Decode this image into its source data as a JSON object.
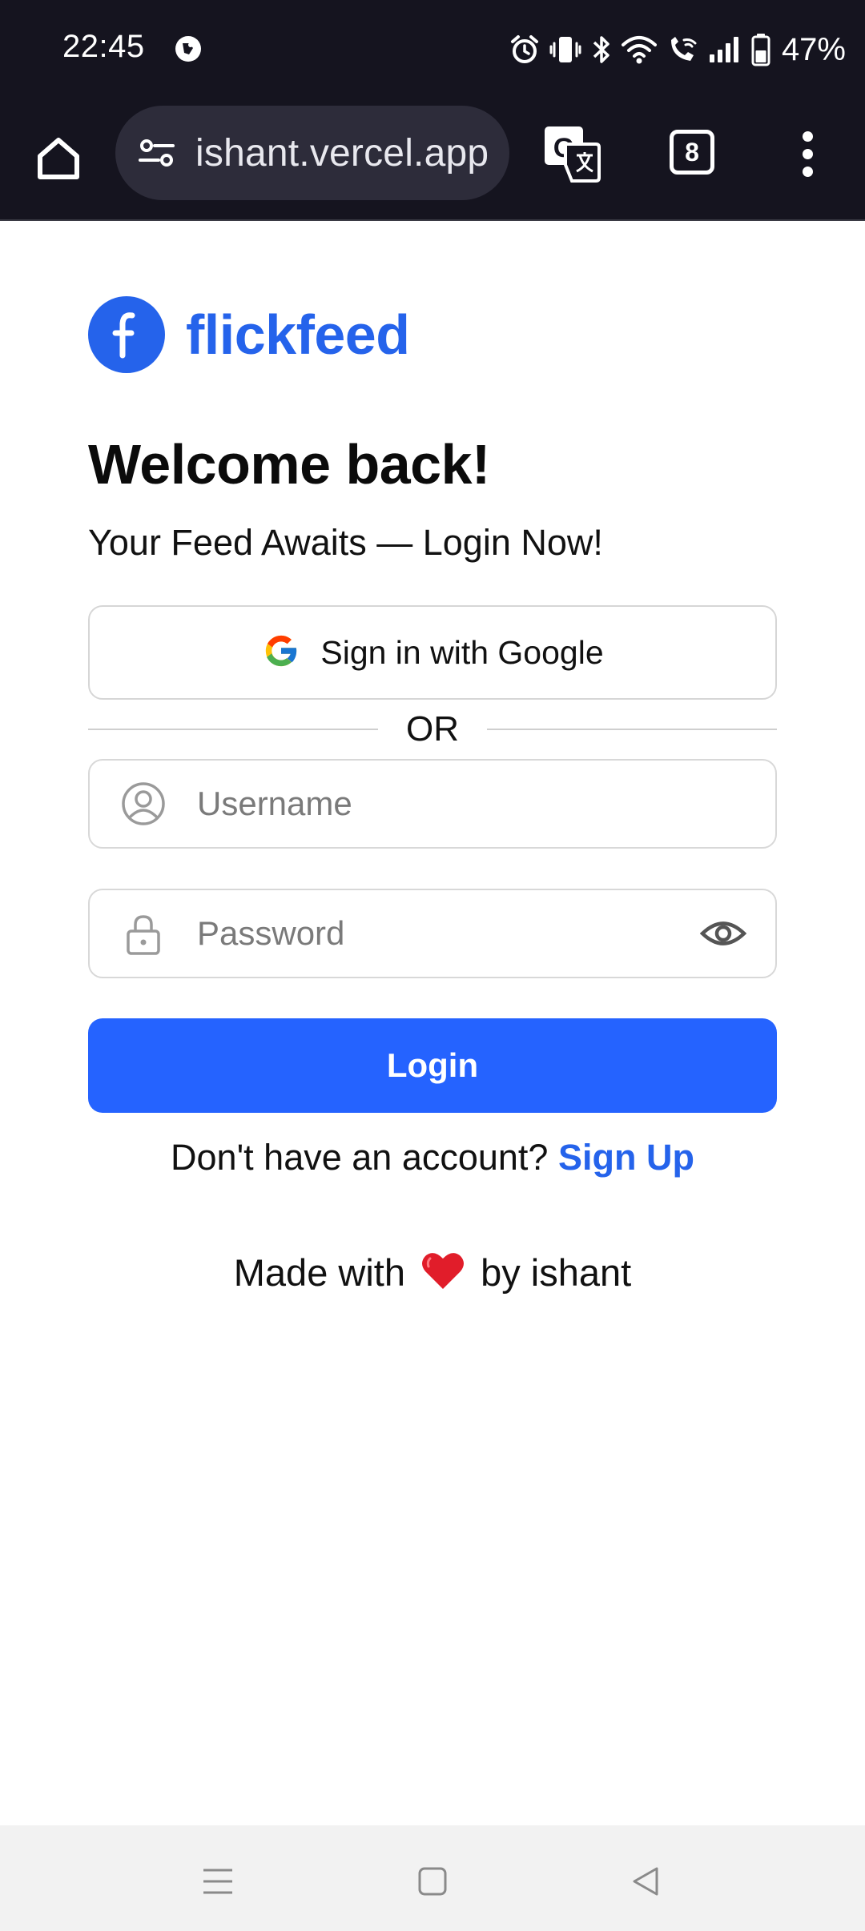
{
  "status_bar": {
    "time": "22:45",
    "battery_percent": "47%",
    "icons": [
      "app-notification-icon",
      "alarm-icon",
      "vibrate-icon",
      "bluetooth-icon",
      "wifi-icon",
      "wifi-calling-icon",
      "signal-icon",
      "battery-icon"
    ]
  },
  "browser": {
    "url": "ishant.vercel.app",
    "tab_count": "8",
    "icons": [
      "home-icon",
      "site-settings-icon",
      "translate-icon",
      "tabs-icon",
      "more-menu-icon"
    ]
  },
  "brand": {
    "logo_letter": "f",
    "name": "flickfeed",
    "color": "#2563eb"
  },
  "login": {
    "heading": "Welcome back!",
    "subtitle": "Your Feed Awaits — Login Now!",
    "google_button": "Sign in with Google",
    "divider": "OR",
    "username_placeholder": "Username",
    "password_placeholder": "Password",
    "submit_button": "Login",
    "submit_color": "#2563ff",
    "signup_prompt": "Don't have an account?",
    "signup_link": "Sign Up"
  },
  "footer": {
    "made_with": "Made with",
    "by": "by ishant"
  },
  "nav_bar": {
    "icons": [
      "recents-icon",
      "home-icon",
      "back-icon"
    ]
  }
}
